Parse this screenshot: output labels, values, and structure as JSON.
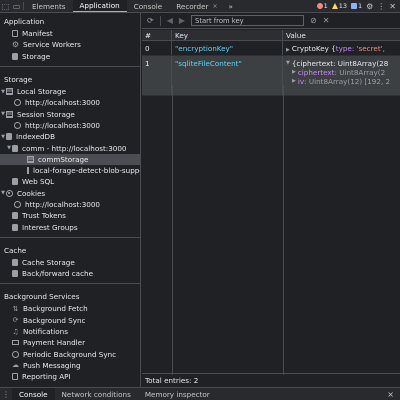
{
  "topbar": {
    "tabs": [
      {
        "label": "Elements"
      },
      {
        "label": "Application"
      },
      {
        "label": "Console"
      },
      {
        "label": "Recorder"
      }
    ],
    "recorder_close": "×",
    "more": "»",
    "errors": "1",
    "warnings": "13",
    "issues": "1",
    "colors": {
      "accent": "#8ab4f8",
      "error": "#f28b82",
      "warning": "#fdd663"
    }
  },
  "sidebar": {
    "application_title": "Application",
    "application_items": [
      "Manifest",
      "Service Workers",
      "Storage"
    ],
    "storage_title": "Storage",
    "local_storage": "Local Storage",
    "local_storage_origin": "http://localhost:3000",
    "session_storage": "Session Storage",
    "session_storage_origin": "http://localhost:3000",
    "indexeddb": "IndexedDB",
    "indexeddb_db": "comm - http://localhost:3000",
    "indexeddb_store_selected": "commStorage",
    "indexeddb_store_other": "local-forage-detect-blob-support",
    "web_sql": "Web SQL",
    "cookies": "Cookies",
    "cookies_origin": "http://localhost:3000",
    "trust_tokens": "Trust Tokens",
    "interest_groups": "Interest Groups",
    "cache_title": "Cache",
    "cache_items": [
      "Cache Storage",
      "Back/forward cache"
    ],
    "background_title": "Background Services",
    "background_items": [
      "Background Fetch",
      "Background Sync",
      "Notifications",
      "Payment Handler",
      "Periodic Background Sync",
      "Push Messaging",
      "Reporting API"
    ]
  },
  "main": {
    "filter_placeholder": "Start from key",
    "columns": [
      "#",
      "Key",
      "Value"
    ],
    "rows": [
      {
        "index": "0",
        "key": "\"encryptionKey\"",
        "value_prefix": "CryptoKey {",
        "value_rest_a": "type: ",
        "value_rest_b": "'secret', "
      },
      {
        "index": "1",
        "key": "\"sqliteFileContent\"",
        "value_line1": "{ciphertext: Uint8Array(28",
        "value_line2_prop": "ciphertext",
        "value_line2_val": ": Uint8Array(2",
        "value_line3_prop": "iv",
        "value_line3_val": ": Uint8Array(12) [192, 2"
      }
    ],
    "footer": "Total entries: 2"
  },
  "drawer": {
    "tabs": [
      {
        "label": "Console"
      },
      {
        "label": "Network conditions"
      },
      {
        "label": "Memory inspector"
      }
    ],
    "close": "×"
  }
}
